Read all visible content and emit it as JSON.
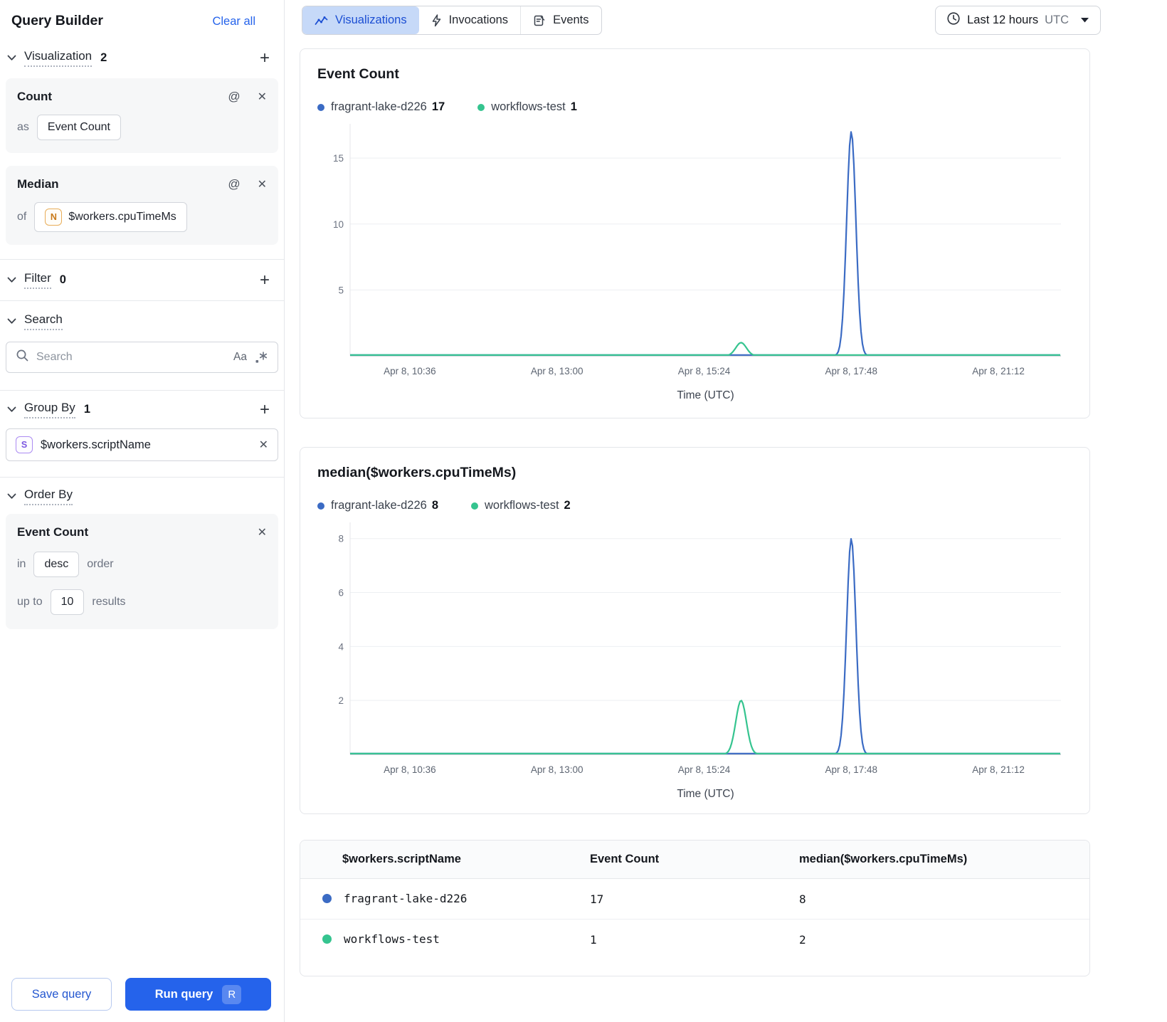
{
  "colors": {
    "accent": "#2563eb",
    "series_blue": "#3b6bc4",
    "series_green": "#35c48f",
    "tab_selected_bg": "#c6d9f8"
  },
  "icons": {
    "at-icon": "@",
    "close-icon": "✕",
    "plus-icon": "+",
    "case-sensitive-icon": "Aa"
  },
  "sidebar": {
    "title": "Query Builder",
    "clear_all": "Clear all",
    "visualization": {
      "label": "Visualization",
      "count": "2",
      "cards": [
        {
          "title": "Count",
          "prefix": "as",
          "value": "Event Count"
        },
        {
          "title": "Median",
          "prefix": "of",
          "field_badge": "N",
          "value": "$workers.cpuTimeMs"
        }
      ]
    },
    "filter": {
      "label": "Filter",
      "count": "0"
    },
    "search": {
      "label": "Search",
      "placeholder": "Search"
    },
    "group_by": {
      "label": "Group By",
      "count": "1",
      "chips": [
        {
          "badge": "S",
          "value": "$workers.scriptName"
        }
      ]
    },
    "order_by": {
      "label": "Order By",
      "card": {
        "title": "Event Count",
        "in_label": "in",
        "direction": "desc",
        "order_label": "order",
        "up_to_label": "up to",
        "limit": "10",
        "results_label": "results"
      }
    },
    "save_button": "Save query",
    "run_button": "Run query",
    "run_shortcut": "R"
  },
  "header": {
    "tabs": [
      {
        "label": "Visualizations",
        "active": true
      },
      {
        "label": "Invocations",
        "active": false
      },
      {
        "label": "Events",
        "active": false
      }
    ],
    "time_range": {
      "label": "Last 12 hours",
      "timezone": "UTC"
    }
  },
  "chart_data": [
    {
      "type": "line",
      "title": "Event Count",
      "xlabel": "Time (UTC)",
      "x_ticks": [
        "Apr 8, 10:36",
        "Apr 8, 13:00",
        "Apr 8, 15:24",
        "Apr 8, 17:48",
        "Apr 8, 21:12"
      ],
      "y_ticks": [
        5,
        10,
        15
      ],
      "ylim": [
        0,
        17.6
      ],
      "grid": true,
      "legend": [
        {
          "name": "fragrant-lake-d226",
          "value": "17",
          "color": "#3b6bc4"
        },
        {
          "name": "workflows-test",
          "value": "1",
          "color": "#35c48f"
        }
      ],
      "series": [
        {
          "name": "fragrant-lake-d226",
          "color": "#3b6bc4",
          "peak_x": 0.705,
          "peak_value": 17,
          "sigma": 0.0065,
          "baseline": 0
        },
        {
          "name": "workflows-test",
          "color": "#35c48f",
          "peak_x": 0.55,
          "peak_value": 1,
          "sigma": 0.0075,
          "baseline": 0
        }
      ]
    },
    {
      "type": "line",
      "title": "median($workers.cpuTimeMs)",
      "xlabel": "Time (UTC)",
      "x_ticks": [
        "Apr 8, 10:36",
        "Apr 8, 13:00",
        "Apr 8, 15:24",
        "Apr 8, 17:48",
        "Apr 8, 21:12"
      ],
      "y_ticks": [
        2,
        4,
        6,
        8
      ],
      "ylim": [
        0,
        8.6
      ],
      "grid": true,
      "legend": [
        {
          "name": "fragrant-lake-d226",
          "value": "8",
          "color": "#3b6bc4"
        },
        {
          "name": "workflows-test",
          "value": "2",
          "color": "#35c48f"
        }
      ],
      "series": [
        {
          "name": "fragrant-lake-d226",
          "color": "#3b6bc4",
          "peak_x": 0.705,
          "peak_value": 8,
          "sigma": 0.0065,
          "baseline": 0
        },
        {
          "name": "workflows-test",
          "color": "#35c48f",
          "peak_x": 0.55,
          "peak_value": 2,
          "sigma": 0.0075,
          "baseline": 0
        }
      ]
    }
  ],
  "table": {
    "columns": [
      "$workers.scriptName",
      "Event Count",
      "median($workers.cpuTimeMs)"
    ],
    "rows": [
      {
        "color": "#3b6bc4",
        "name": "fragrant-lake-d226",
        "event_count": "17",
        "median": "8"
      },
      {
        "color": "#35c48f",
        "name": "workflows-test",
        "event_count": "1",
        "median": "2"
      }
    ]
  }
}
